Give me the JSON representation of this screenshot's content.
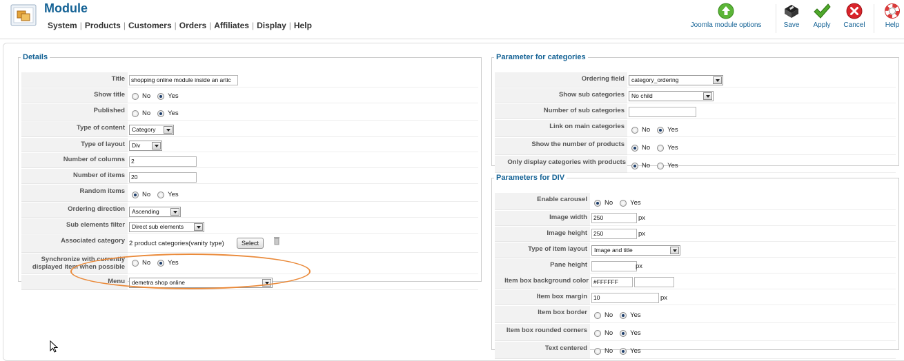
{
  "header": {
    "title": "Module",
    "nav": [
      "System",
      "Products",
      "Customers",
      "Orders",
      "Affiliates",
      "Display",
      "Help"
    ],
    "toolbar": {
      "options_label": "Joomla module options",
      "save_label": "Save",
      "apply_label": "Apply",
      "cancel_label": "Cancel",
      "help_label": "Help"
    }
  },
  "details": {
    "legend": "Details",
    "title_label": "Title",
    "title_value": "shopping online module inside an artic",
    "show_title_label": "Show title",
    "published_label": "Published",
    "type_content_label": "Type of content",
    "type_content_value": "Category",
    "type_layout_label": "Type of layout",
    "type_layout_value": "Div",
    "num_columns_label": "Number of columns",
    "num_columns_value": "2",
    "num_items_label": "Number of items",
    "num_items_value": "20",
    "random_items_label": "Random items",
    "ordering_direction_label": "Ordering direction",
    "ordering_direction_value": "Ascending",
    "sub_elements_label": "Sub elements filter",
    "sub_elements_value": "Direct sub elements",
    "assoc_category_label": "Associated category",
    "assoc_category_value": "2 product categories(vanity type)",
    "select_button": "Select",
    "sync_label_1": "Synchronize with currently",
    "sync_label_2": "displayed item when possible",
    "menu_label": "Menu",
    "menu_value": "demetra shop online"
  },
  "categories": {
    "legend": "Parameter for categories",
    "ordering_field_label": "Ordering field",
    "ordering_field_value": "category_ordering",
    "show_sub_label": "Show sub categories",
    "show_sub_value": "No child",
    "num_sub_label": "Number of sub categories",
    "num_sub_value": "",
    "link_main_label": "Link on main categories",
    "show_num_products_label": "Show the number of products",
    "only_display_label": "Only display categories with products"
  },
  "div_params": {
    "legend": "Parameters for DIV",
    "carousel_label": "Enable carousel",
    "img_width_label": "Image width",
    "img_width_value": "250",
    "img_height_label": "Image height",
    "img_height_value": "250",
    "item_layout_label": "Type of item layout",
    "item_layout_value": "Image and title",
    "pane_height_label": "Pane height",
    "pane_height_value": "",
    "bg_color_label": "Item box background color",
    "bg_color_value": "#FFFFFF",
    "margin_label": "Item box margin",
    "margin_value": "10",
    "border_label": "Item box border",
    "rounded_label": "Item box rounded corners",
    "centered_label": "Text centered",
    "px_unit": "px"
  },
  "radio": {
    "no": "No",
    "yes": "Yes"
  },
  "colors": {
    "accent": "#146295",
    "highlight": "#ea8a3a"
  }
}
